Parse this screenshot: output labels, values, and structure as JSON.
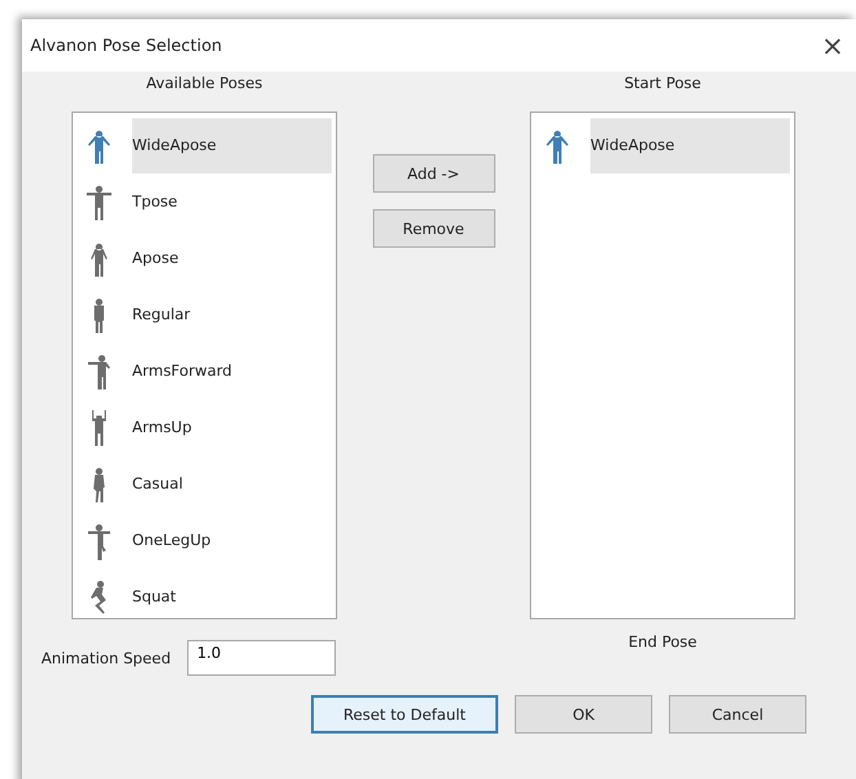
{
  "window": {
    "title": "Alvanon Pose Selection",
    "close": "×"
  },
  "available": {
    "label": "Available Poses",
    "items": [
      {
        "label": "WideApose",
        "kind": "wide",
        "selected": true
      },
      {
        "label": "Tpose",
        "kind": "t",
        "selected": false
      },
      {
        "label": "Apose",
        "kind": "a",
        "selected": false
      },
      {
        "label": "Regular",
        "kind": "regular",
        "selected": false
      },
      {
        "label": "ArmsForward",
        "kind": "forward",
        "selected": false
      },
      {
        "label": "ArmsUp",
        "kind": "up",
        "selected": false
      },
      {
        "label": "Casual",
        "kind": "casual",
        "selected": false
      },
      {
        "label": "OneLegUp",
        "kind": "oneleg",
        "selected": false
      },
      {
        "label": "Squat",
        "kind": "squat",
        "selected": false
      }
    ]
  },
  "middle_buttons": [
    "Add ->",
    "Remove"
  ],
  "start": {
    "label": "Start Pose",
    "items": [
      {
        "label": "WideApose",
        "kind": "wide",
        "selected": true
      }
    ]
  },
  "end_label": "End Pose",
  "animation_speed": {
    "label": "Animation Speed",
    "value": "1.0"
  },
  "buttons": [
    {
      "label": "Reset to Default",
      "focused": true
    },
    {
      "label": "OK",
      "focused": false
    },
    {
      "label": "Cancel",
      "focused": false
    }
  ]
}
